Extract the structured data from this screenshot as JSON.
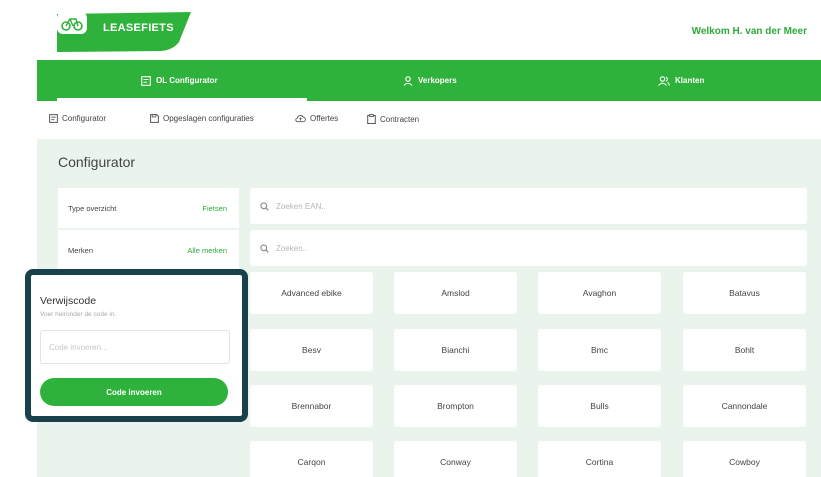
{
  "brand": {
    "logo_text": "LEASEFIETS"
  },
  "header": {
    "welcome": "Welkom H. van der Meer"
  },
  "main_nav": [
    {
      "label": "OL Configurator",
      "icon": "configurator-icon",
      "active": true
    },
    {
      "label": "Verkopers",
      "icon": "user-icon"
    },
    {
      "label": "Klanten",
      "icon": "users-icon"
    }
  ],
  "sub_nav": [
    {
      "label": "Configurator",
      "icon": "configurator-icon"
    },
    {
      "label": "Opgeslagen configuraties",
      "icon": "save-icon"
    },
    {
      "label": "Offertes",
      "icon": "cloud-icon"
    },
    {
      "label": "Contracten",
      "icon": "clipboard-icon"
    }
  ],
  "page": {
    "title": "Configurator"
  },
  "filters": [
    {
      "label": "Type overzicht",
      "value": "Fietsen"
    },
    {
      "label": "Merken",
      "value": "Alle merken"
    }
  ],
  "search": {
    "ean_placeholder": "Zoeken EAN..",
    "placeholder": "Zoeken.."
  },
  "brands": [
    "Advanced ebike",
    "Amslod",
    "Avaghon",
    "Batavus",
    "Besv",
    "Bianchi",
    "Bmc",
    "Bohlt",
    "Brennabor",
    "Brompton",
    "Bulls",
    "Cannondale",
    "Carqon",
    "Conway",
    "Cortina",
    "Cowboy"
  ],
  "referral": {
    "title": "Verwijscode",
    "subtitle": "Voer hieronder de code in.",
    "placeholder": "Code invoeren...",
    "button": "Code invoeren"
  },
  "colors": {
    "accent": "#2fb23c",
    "accent_text": "#2fa83a",
    "background": "#ebf4ec",
    "highlight_border": "#19414b"
  }
}
